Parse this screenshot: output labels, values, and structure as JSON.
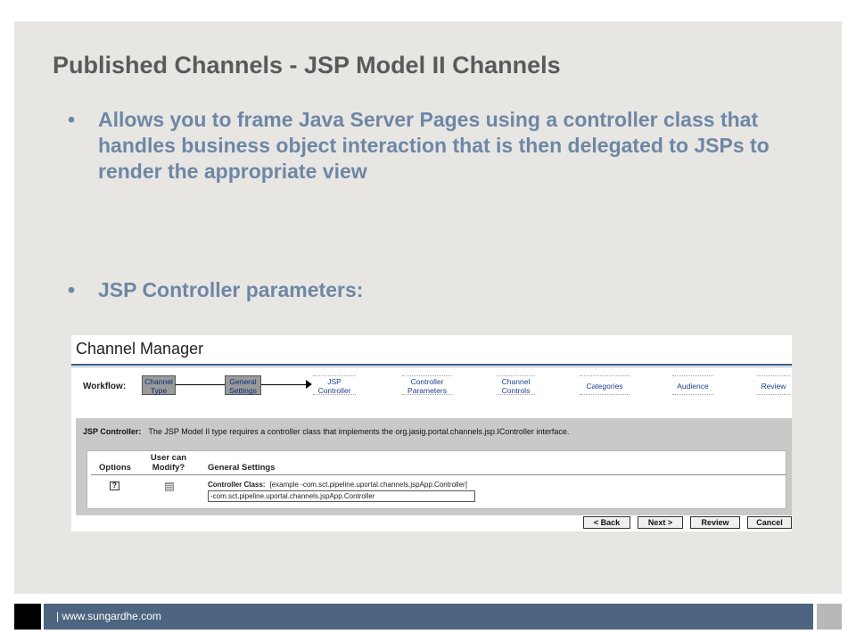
{
  "slide": {
    "title": "Published Channels - JSP Model II Channels",
    "bullet_symbol": "•",
    "bullets": [
      "Allows you to frame Java Server Pages using a controller class that handles business object interaction that is then delegated to JSPs to render the appropriate view",
      "JSP Controller parameters:"
    ],
    "footer": "| www.sungardhe.com"
  },
  "channel_manager": {
    "title": "Channel Manager",
    "workflow_label": "Workflow:",
    "steps": [
      {
        "line1": "Channel",
        "line2": "Type"
      },
      {
        "line1": "General",
        "line2": "Settings"
      },
      {
        "line1": "JSP",
        "line2": "Controller"
      },
      {
        "line1": "Controller",
        "line2": "Parameters"
      },
      {
        "line1": "Channel",
        "line2": "Controls"
      },
      {
        "line1": "Categories",
        "line2": ""
      },
      {
        "line1": "Audience",
        "line2": ""
      },
      {
        "line1": "Review",
        "line2": ""
      }
    ],
    "jsp_label": "JSP Controller:",
    "jsp_description": "The JSP Model II type requires a controller class that implements the org.jasig.portal.channels.jsp.IController interface.",
    "columns": {
      "options": "Options",
      "user_modify_line1": "User can",
      "user_modify_line2": "Modify?",
      "general": "General Settings"
    },
    "help_glyph": "?",
    "controller_class_label": "Controller Class:",
    "controller_class_example": "[example -com.sct.pipeline.uportal.channels.jspApp.Controller]",
    "controller_class_value": "-com.sct.pipeline.uportal.channels.jspApp.Controller",
    "buttons": {
      "back": "< Back",
      "next": "Next >",
      "review": "Review",
      "cancel": "Cancel"
    }
  }
}
